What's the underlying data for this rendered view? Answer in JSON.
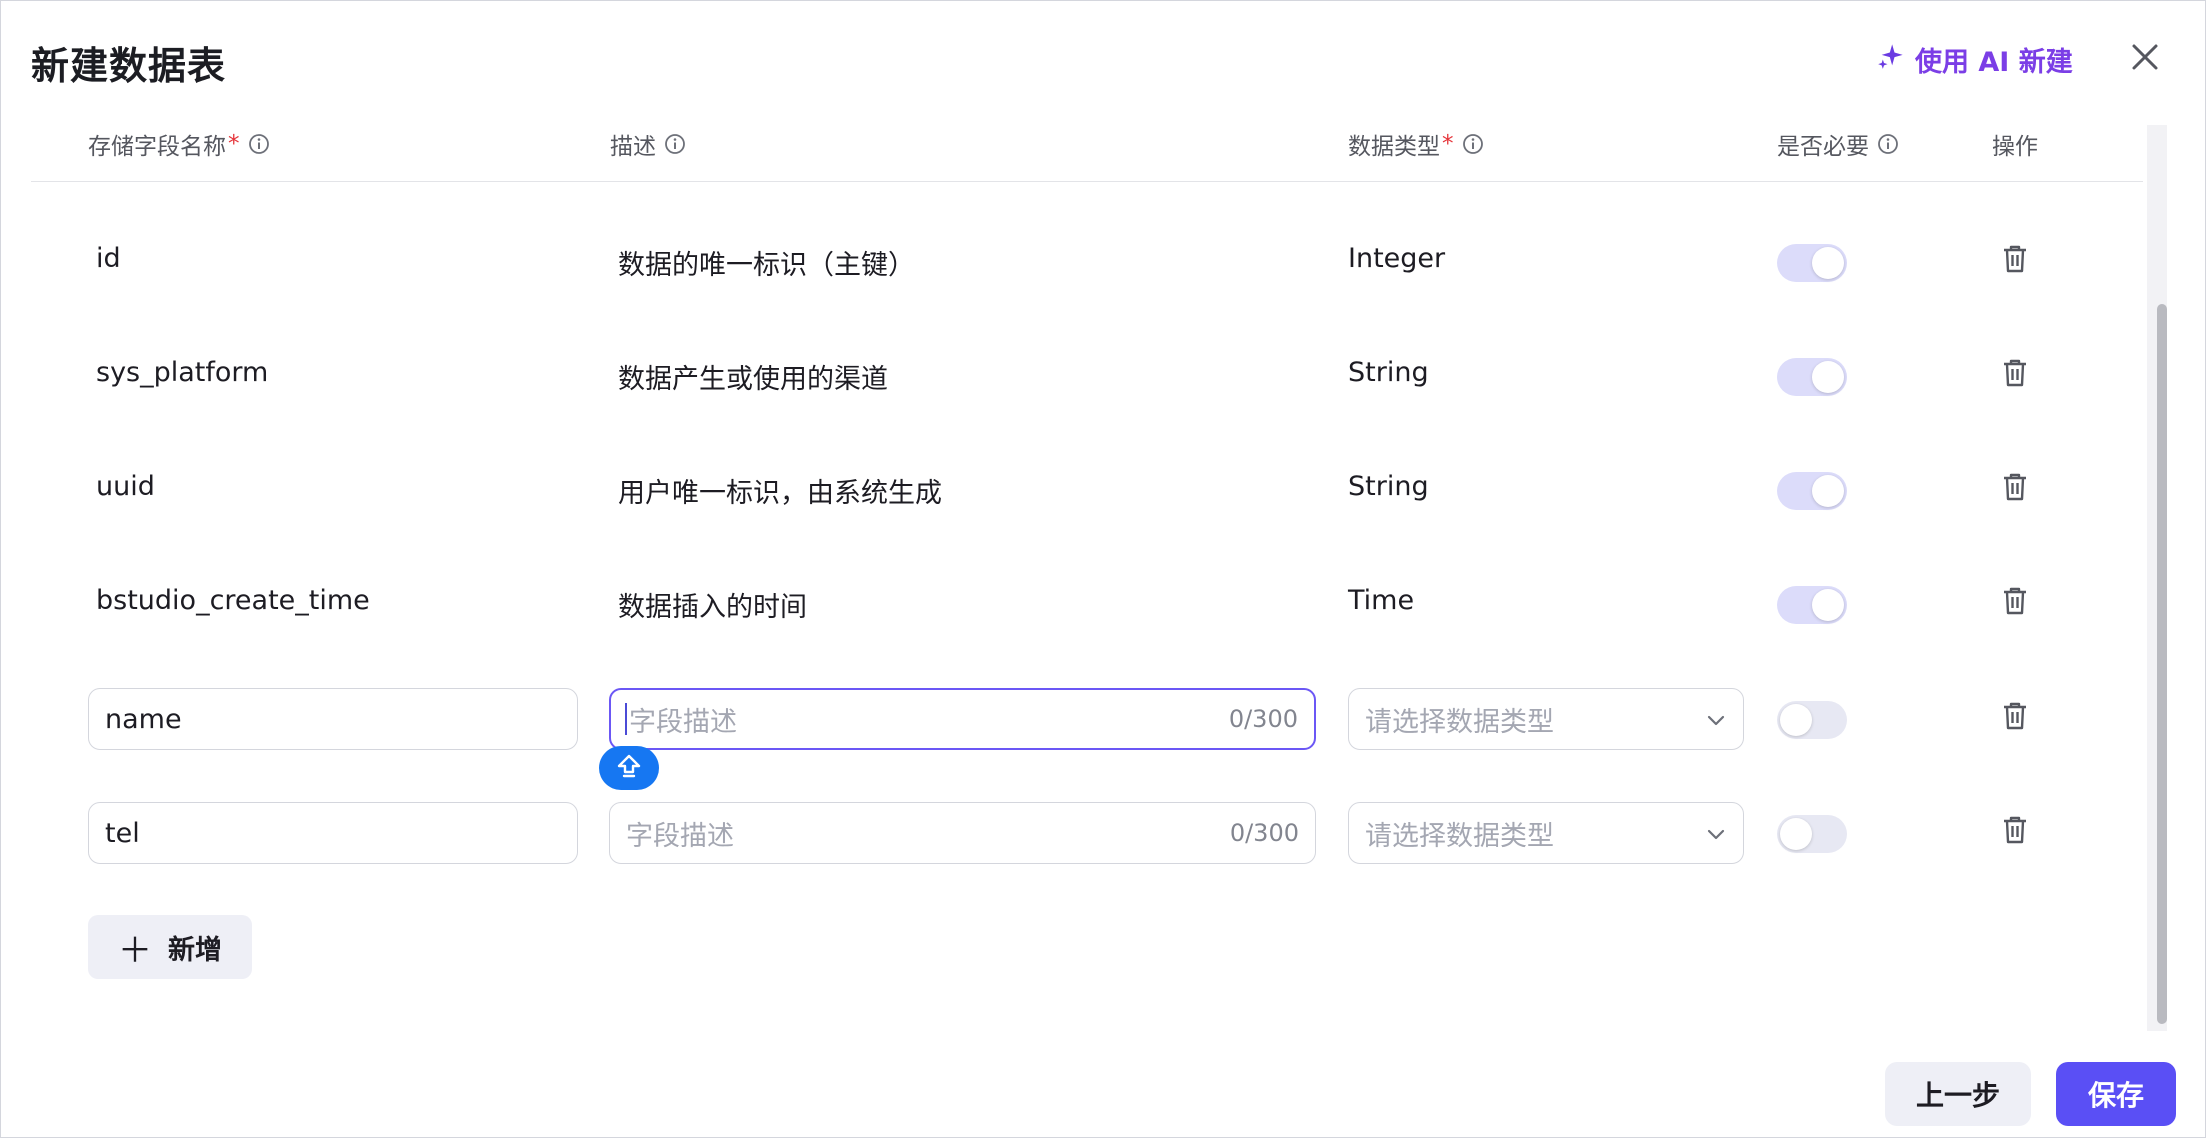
{
  "dialog": {
    "title": "新建数据表",
    "ai_create_label": "使用 AI 新建"
  },
  "columns": {
    "name": "存储字段名称",
    "desc": "描述",
    "type": "数据类型",
    "required": "是否必要",
    "actions": "操作",
    "required_mark": "*"
  },
  "system_fields": [
    {
      "name": "id",
      "desc": "数据的唯一标识（主键）",
      "type": "Integer",
      "required": true
    },
    {
      "name": "sys_platform",
      "desc": "数据产生或使用的渠道",
      "type": "String",
      "required": true
    },
    {
      "name": "uuid",
      "desc": "用户唯一标识，由系统生成",
      "type": "String",
      "required": true
    },
    {
      "name": "bstudio_create_time",
      "desc": "数据插入的时间",
      "type": "Time",
      "required": true
    }
  ],
  "editable_fields": [
    {
      "name": "name",
      "desc_placeholder": "字段描述",
      "desc_value": "",
      "counter": "0/300",
      "type_placeholder": "请选择数据类型",
      "required": false,
      "focused": true
    },
    {
      "name": "tel",
      "desc_placeholder": "字段描述",
      "desc_value": "",
      "counter": "0/300",
      "type_placeholder": "请选择数据类型",
      "required": false,
      "focused": false
    }
  ],
  "add_button_label": "新增",
  "footer": {
    "prev_label": "上一步",
    "save_label": "保存"
  },
  "colors": {
    "accent": "#5a4ff5",
    "ai_purple": "#7b3ee6",
    "required_red": "#e5343a"
  }
}
